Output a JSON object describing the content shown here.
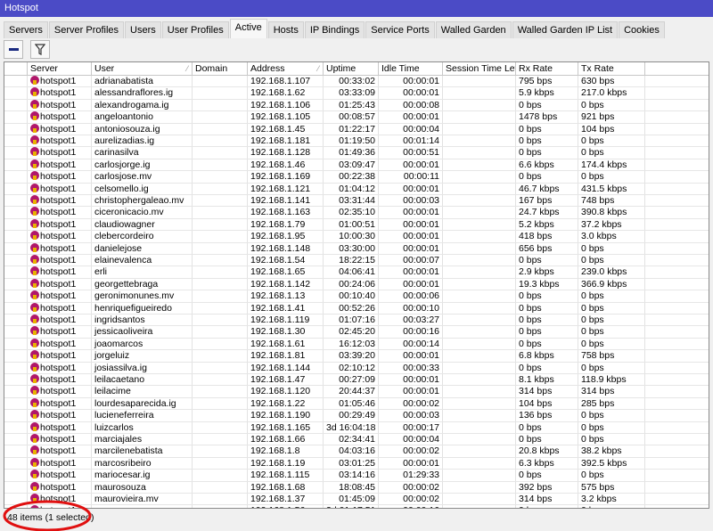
{
  "window": {
    "title": "Hotspot"
  },
  "tabs": [
    "Servers",
    "Server Profiles",
    "Users",
    "User Profiles",
    "Active",
    "Hosts",
    "IP Bindings",
    "Service Ports",
    "Walled Garden",
    "Walled Garden IP List",
    "Cookies"
  ],
  "active_tab": "Active",
  "toolbar": {
    "remove_icon": "minus-icon",
    "filter_icon": "filter-icon"
  },
  "columns": [
    "",
    "Server",
    "User",
    "Domain",
    "Address",
    "Uptime",
    "Idle Time",
    "Session Time Left",
    "Rx Rate",
    "Tx Rate"
  ],
  "sorted_column": "User",
  "rows": [
    [
      "hotspot1",
      "adrianabatista",
      "",
      "192.168.1.107",
      "00:33:02",
      "00:00:01",
      "",
      "795 bps",
      "630 bps"
    ],
    [
      "hotspot1",
      "alessandraflores.ig",
      "",
      "192.168.1.62",
      "03:33:09",
      "00:00:01",
      "",
      "5.9 kbps",
      "217.0 kbps"
    ],
    [
      "hotspot1",
      "alexandrogama.ig",
      "",
      "192.168.1.106",
      "01:25:43",
      "00:00:08",
      "",
      "0 bps",
      "0 bps"
    ],
    [
      "hotspot1",
      "angeloantonio",
      "",
      "192.168.1.105",
      "00:08:57",
      "00:00:01",
      "",
      "1478 bps",
      "921 bps"
    ],
    [
      "hotspot1",
      "antoniosouza.ig",
      "",
      "192.168.1.45",
      "01:22:17",
      "00:00:04",
      "",
      "0 bps",
      "104 bps"
    ],
    [
      "hotspot1",
      "aurelizadias.ig",
      "",
      "192.168.1.181",
      "01:19:50",
      "00:01:14",
      "",
      "0 bps",
      "0 bps"
    ],
    [
      "hotspot1",
      "carinasilva",
      "",
      "192.168.1.128",
      "01:49:36",
      "00:00:51",
      "",
      "0 bps",
      "0 bps"
    ],
    [
      "hotspot1",
      "carlosjorge.ig",
      "",
      "192.168.1.46",
      "03:09:47",
      "00:00:01",
      "",
      "6.6 kbps",
      "174.4 kbps"
    ],
    [
      "hotspot1",
      "carlosjose.mv",
      "",
      "192.168.1.169",
      "00:22:38",
      "00:00:11",
      "",
      "0 bps",
      "0 bps"
    ],
    [
      "hotspot1",
      "celsomello.ig",
      "",
      "192.168.1.121",
      "01:04:12",
      "00:00:01",
      "",
      "46.7 kbps",
      "431.5 kbps"
    ],
    [
      "hotspot1",
      "christophergaleao.mv",
      "",
      "192.168.1.141",
      "03:31:44",
      "00:00:03",
      "",
      "167 bps",
      "748 bps"
    ],
    [
      "hotspot1",
      "ciceronicacio.mv",
      "",
      "192.168.1.163",
      "02:35:10",
      "00:00:01",
      "",
      "24.7 kbps",
      "390.8 kbps"
    ],
    [
      "hotspot1",
      "claudiowagner",
      "",
      "192.168.1.79",
      "01:00:51",
      "00:00:01",
      "",
      "5.2 kbps",
      "37.2 kbps"
    ],
    [
      "hotspot1",
      "clebercordeiro",
      "",
      "192.168.1.95",
      "10:00:30",
      "00:00:01",
      "",
      "418 bps",
      "3.0 kbps"
    ],
    [
      "hotspot1",
      "danielejose",
      "",
      "192.168.1.148",
      "03:30:00",
      "00:00:01",
      "",
      "656 bps",
      "0 bps"
    ],
    [
      "hotspot1",
      "elainevalenca",
      "",
      "192.168.1.54",
      "18:22:15",
      "00:00:07",
      "",
      "0 bps",
      "0 bps"
    ],
    [
      "hotspot1",
      "erli",
      "",
      "192.168.1.65",
      "04:06:41",
      "00:00:01",
      "",
      "2.9 kbps",
      "239.0 kbps"
    ],
    [
      "hotspot1",
      "georgettebraga",
      "",
      "192.168.1.142",
      "00:24:06",
      "00:00:01",
      "",
      "19.3 kbps",
      "366.9 kbps"
    ],
    [
      "hotspot1",
      "geronimonunes.mv",
      "",
      "192.168.1.13",
      "00:10:40",
      "00:00:06",
      "",
      "0 bps",
      "0 bps"
    ],
    [
      "hotspot1",
      "henriquefigueiredo",
      "",
      "192.168.1.41",
      "00:52:26",
      "00:00:10",
      "",
      "0 bps",
      "0 bps"
    ],
    [
      "hotspot1",
      "ingridsantos",
      "",
      "192.168.1.119",
      "01:07:16",
      "00:03:27",
      "",
      "0 bps",
      "0 bps"
    ],
    [
      "hotspot1",
      "jessicaoliveira",
      "",
      "192.168.1.30",
      "02:45:20",
      "00:00:16",
      "",
      "0 bps",
      "0 bps"
    ],
    [
      "hotspot1",
      "joaomarcos",
      "",
      "192.168.1.61",
      "16:12:03",
      "00:00:14",
      "",
      "0 bps",
      "0 bps"
    ],
    [
      "hotspot1",
      "jorgeluiz",
      "",
      "192.168.1.81",
      "03:39:20",
      "00:00:01",
      "",
      "6.8 kbps",
      "758 bps"
    ],
    [
      "hotspot1",
      "josiassilva.ig",
      "",
      "192.168.1.144",
      "02:10:12",
      "00:00:33",
      "",
      "0 bps",
      "0 bps"
    ],
    [
      "hotspot1",
      "leilacaetano",
      "",
      "192.168.1.47",
      "00:27:09",
      "00:00:01",
      "",
      "8.1 kbps",
      "118.9 kbps"
    ],
    [
      "hotspot1",
      "leilacime",
      "",
      "192.168.1.120",
      "20:44:37",
      "00:00:01",
      "",
      "314 bps",
      "314 bps"
    ],
    [
      "hotspot1",
      "lourdesaparecida.ig",
      "",
      "192.168.1.22",
      "01:05:46",
      "00:00:02",
      "",
      "104 bps",
      "285 bps"
    ],
    [
      "hotspot1",
      "lucieneferreira",
      "",
      "192.168.1.190",
      "00:29:49",
      "00:00:03",
      "",
      "136 bps",
      "0 bps"
    ],
    [
      "hotspot1",
      "luizcarlos",
      "",
      "192.168.1.165",
      "3d 16:04:18",
      "00:00:17",
      "",
      "0 bps",
      "0 bps"
    ],
    [
      "hotspot1",
      "marciajales",
      "",
      "192.168.1.66",
      "02:34:41",
      "00:00:04",
      "",
      "0 bps",
      "0 bps"
    ],
    [
      "hotspot1",
      "marcilenebatista",
      "",
      "192.168.1.8",
      "04:03:16",
      "00:00:02",
      "",
      "20.8 kbps",
      "38.2 kbps"
    ],
    [
      "hotspot1",
      "marcosribeiro",
      "",
      "192.168.1.19",
      "03:01:25",
      "00:00:01",
      "",
      "6.3 kbps",
      "392.5 kbps"
    ],
    [
      "hotspot1",
      "mariocesar.ig",
      "",
      "192.168.1.115",
      "03:14:16",
      "01:29:33",
      "",
      "0 bps",
      "0 bps"
    ],
    [
      "hotspot1",
      "maurosouza",
      "",
      "192.168.1.68",
      "18:08:45",
      "00:00:02",
      "",
      "392 bps",
      "575 bps"
    ],
    [
      "hotspot1",
      "maurovieira.mv",
      "",
      "192.168.1.37",
      "01:45:09",
      "00:00:02",
      "",
      "314 bps",
      "3.2 kbps"
    ],
    [
      "hotspot1",
      "",
      "",
      "192.168.1.56",
      "3d 01:17:51",
      "00:00:16",
      "",
      "0 bps",
      "0 bps"
    ]
  ],
  "status": {
    "text": "48 items (1 selected)"
  },
  "colors": {
    "titlebar": "#4b4bc6",
    "server_icon": "#b0176a",
    "annotation": "#e01010"
  }
}
